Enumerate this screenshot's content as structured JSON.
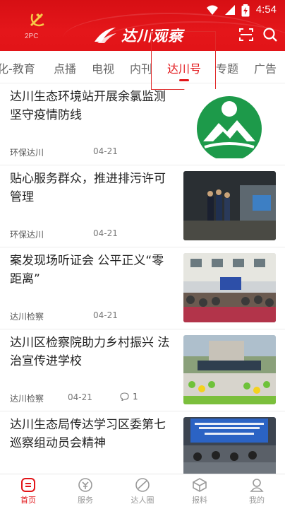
{
  "status_bar": {
    "time": "4:54"
  },
  "header": {
    "emblem_caption": "2PC",
    "logo_text": "达川观察",
    "scan_icon": "scan-icon",
    "search_icon": "search-icon"
  },
  "tabs": [
    {
      "label": "化-教育"
    },
    {
      "label": "点播"
    },
    {
      "label": "电视"
    },
    {
      "label": "内刊"
    },
    {
      "label": "达川号",
      "active": true
    },
    {
      "label": "专题"
    },
    {
      "label": "广告"
    }
  ],
  "feed": [
    {
      "title": "达川生态环境站开展余氯监测 坚守疫情防线",
      "source": "环保达川",
      "date": "04-21"
    },
    {
      "title": "贴心服务群众，推进排污许可管理",
      "source": "环保达川",
      "date": "04-21"
    },
    {
      "title": "案发现场听证会 公平正义“零距离”",
      "source": "达川检察",
      "date": "04-21"
    },
    {
      "title": "达川区检察院助力乡村振兴 法治宣传进学校",
      "source": "达川检察",
      "date": "04-21",
      "comments": "1"
    },
    {
      "title": "达川生态局传达学习区委第七巡察组动员会精神",
      "source": "",
      "date": ""
    }
  ],
  "bottom_nav": [
    {
      "label": "首页",
      "icon": "home-icon",
      "active": true
    },
    {
      "label": "服务",
      "icon": "service-icon"
    },
    {
      "label": "达人圈",
      "icon": "circle-icon"
    },
    {
      "label": "报料",
      "icon": "report-icon"
    },
    {
      "label": "我的",
      "icon": "profile-icon"
    }
  ],
  "colors": {
    "brand_red": "#e21418",
    "text": "#222222",
    "muted": "#777777"
  }
}
